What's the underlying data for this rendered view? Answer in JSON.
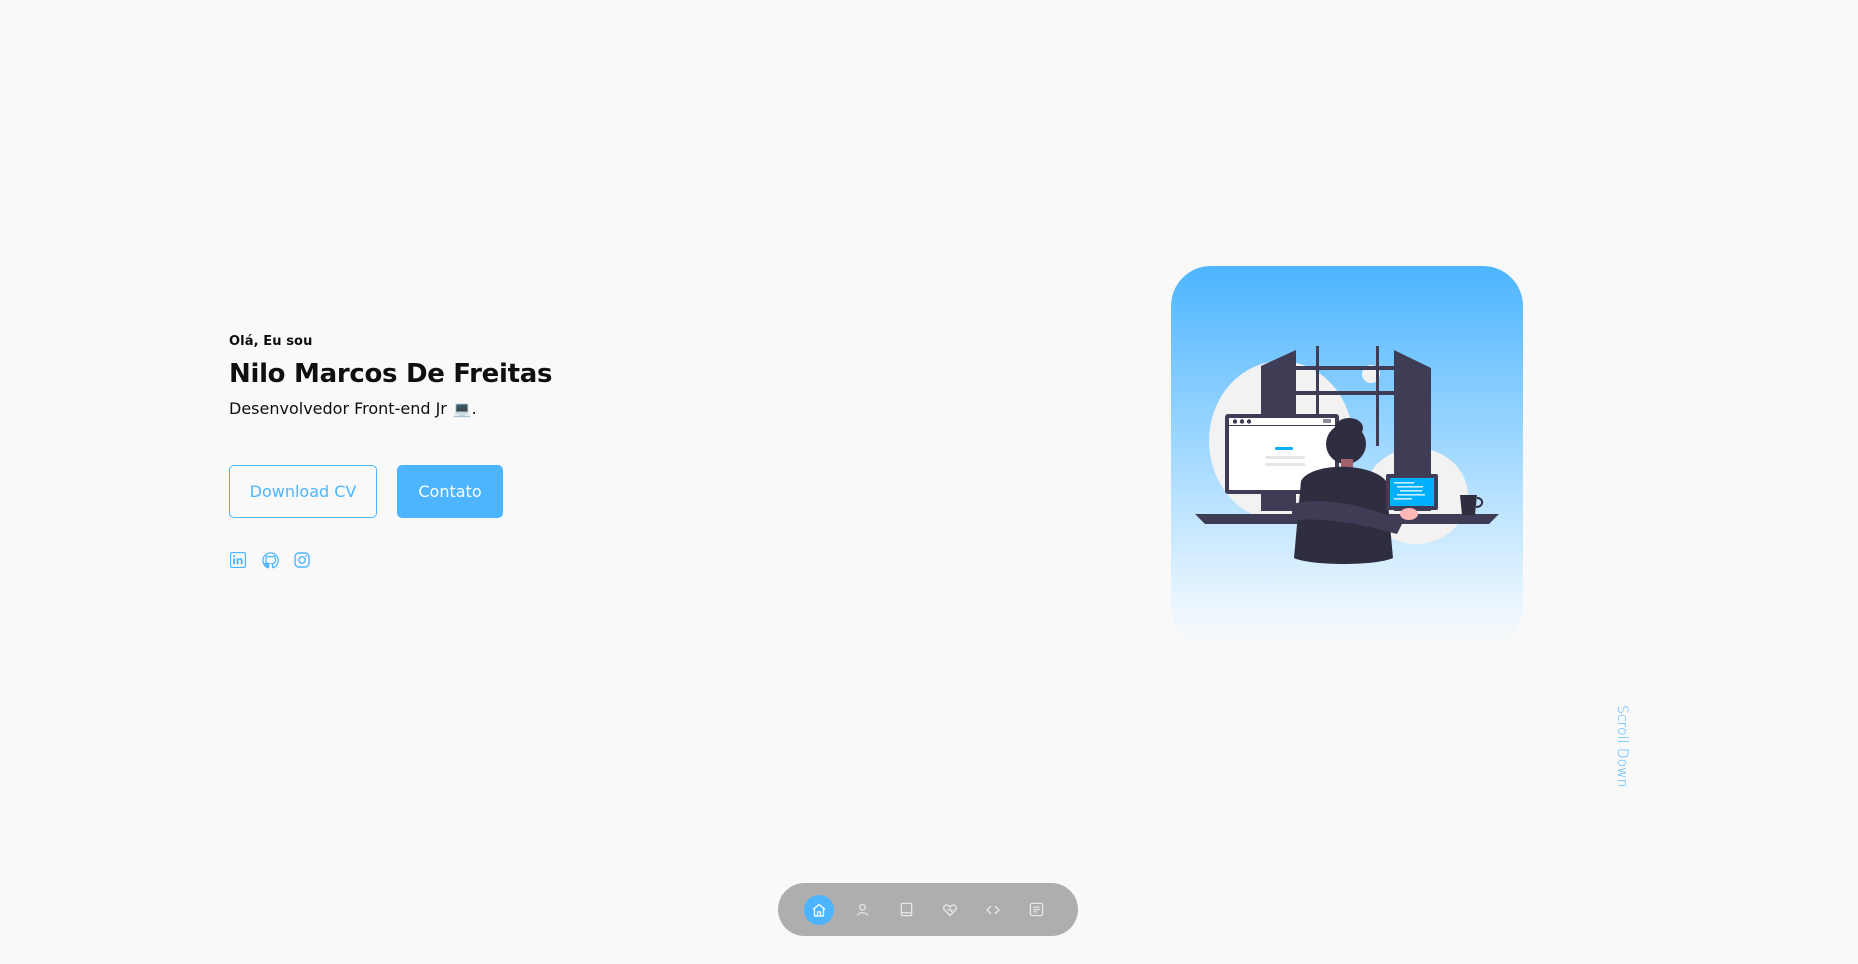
{
  "hero": {
    "greeting": "Olá, Eu sou",
    "name": "Nilo Marcos De Freitas",
    "role": "Desenvolvedor Front-end Jr",
    "role_emoji": "💻",
    "role_suffix": "."
  },
  "buttons": {
    "download_cv": "Download CV",
    "contact": "Contato"
  },
  "socials": [
    {
      "icon": "linkedin-icon"
    },
    {
      "icon": "github-icon"
    },
    {
      "icon": "instagram-icon"
    }
  ],
  "scroll_down": "Scroll Down",
  "nav": {
    "items": [
      {
        "icon": "home-icon",
        "active": true
      },
      {
        "icon": "user-icon",
        "active": false
      },
      {
        "icon": "book-icon",
        "active": false
      },
      {
        "icon": "service-icon",
        "active": false
      },
      {
        "icon": "code-icon",
        "active": false
      },
      {
        "icon": "message-icon",
        "active": false
      }
    ]
  },
  "colors": {
    "accent": "#4db5ff",
    "background": "#f9f9f9",
    "text": "#0f0f0f"
  }
}
